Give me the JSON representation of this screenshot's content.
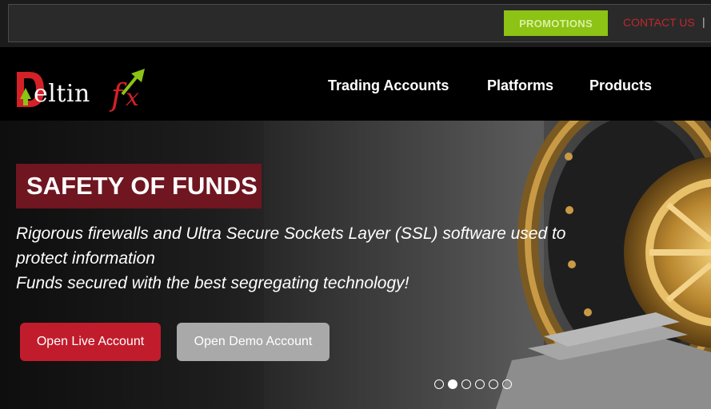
{
  "topbar": {
    "promotions_label": "PROMOTIONS",
    "contact_label": "CONTACT US",
    "separator": "|"
  },
  "brand": {
    "logo_text": "eltin",
    "logo_letters": [
      "D",
      "f",
      "x"
    ]
  },
  "nav": {
    "items": [
      "Trading Accounts",
      "Platforms",
      "Products"
    ]
  },
  "hero": {
    "title": "SAFETY OF FUNDS",
    "lines": [
      "Rigorous firewalls and Ultra Secure Sockets Layer (SSL) software used to",
      "protect information",
      "Funds secured with the best segregating technology!"
    ],
    "live_button": "Open Live Account",
    "demo_button": "Open Demo Account"
  },
  "carousel": {
    "slide_count": 6,
    "active_index": 1
  },
  "colors": {
    "accent_green": "#8cc314",
    "accent_red": "#c11c2c",
    "title_box": "#6f1620"
  }
}
